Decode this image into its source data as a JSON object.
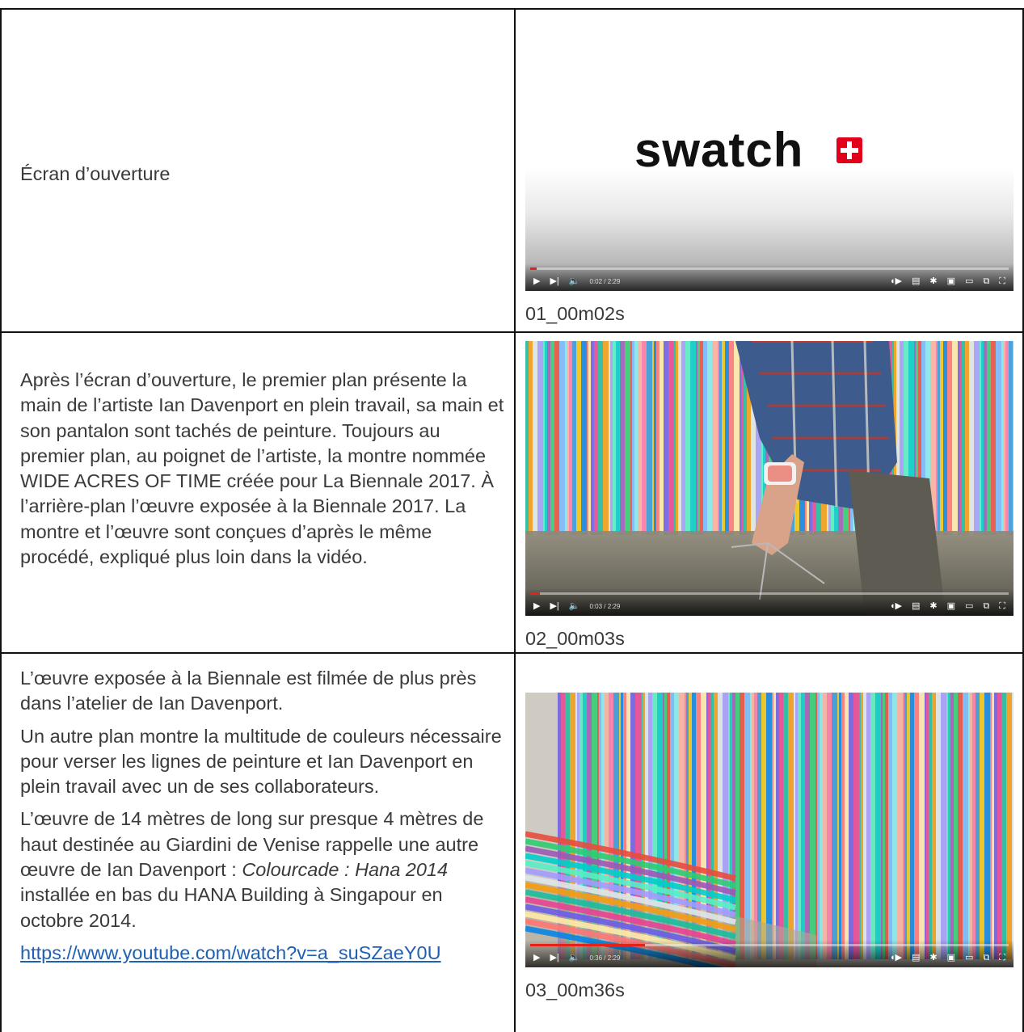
{
  "rows": [
    {
      "text": [
        "Écran d’ouverture"
      ],
      "caption": "01_00m02s",
      "player": {
        "time": "0:02 / 2:29",
        "progress": 0.013,
        "logo": "swatch"
      }
    },
    {
      "text": [
        "Après l’écran d’ouverture, le premier plan présente la main de l’artiste Ian Davenport en plein travail, sa main et son pantalon sont tachés de peinture. Toujours au premier plan, au poignet de l’artiste, la montre nommée WIDE ACRES OF TIME créée pour La Biennale 2017. À l’arrière-plan l’œuvre exposée à la Biennale 2017. La montre et l’œuvre sont conçues d’après le même procédé, expliqué plus loin dans la vidéo."
      ],
      "caption": "02_00m03s",
      "player": {
        "time": "0:03 / 2:29",
        "progress": 0.02
      }
    },
    {
      "text": [
        "L’œuvre exposée à la Biennale est filmée de plus près dans l’atelier de Ian Davenport.",
        "Un autre plan montre la multitude de couleurs nécessaire pour verser les lignes de peinture et Ian Davenport en plein travail avec un de ses collaborateurs."
      ],
      "p3_before": "L’œuvre de 14 mètres de long sur presque 4 mètres de haut destinée au Giardini de Venise rappelle une autre œuvre de Ian Davenport :",
      "p3_italic": "Colourcade : Hana 2014",
      "p3_after": "installée en bas du HANA Building à Singapour en octobre 2014.",
      "link": "https://www.youtube.com/watch?v=a_suSZaeY0U",
      "caption": "03_00m36s",
      "player": {
        "time": "0:36 / 2:29",
        "progress": 0.24
      }
    }
  ],
  "icons": {
    "play": "play-icon",
    "next": "next-icon",
    "volume": "volume-icon",
    "autoplay": "autoplay-toggle-icon",
    "subtitles": "subtitles-icon",
    "settings": "gear-icon",
    "miniplayer": "miniplayer-icon",
    "theater": "theater-icon",
    "cast": "cast-icon",
    "fullscreen": "fullscreen-icon"
  },
  "colors": {
    "logo_red": "#e2001a",
    "progress": "#e62117",
    "link": "#1f5fb4"
  }
}
